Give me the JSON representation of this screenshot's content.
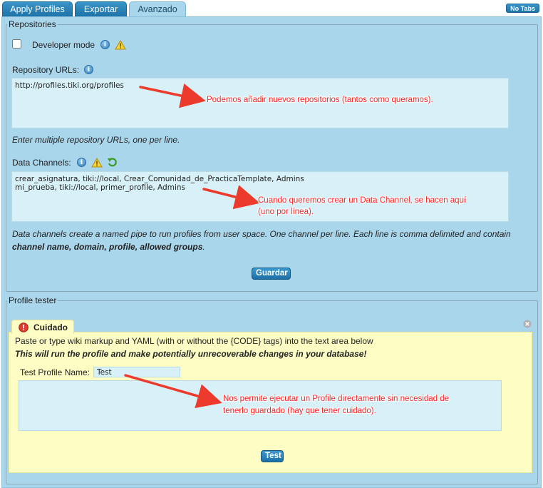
{
  "tabs": [
    {
      "label": "Apply Profiles",
      "active": false
    },
    {
      "label": "Exportar",
      "active": false
    },
    {
      "label": "Avanzado",
      "active": true
    }
  ],
  "no_tabs_label": "No Tabs",
  "repositories": {
    "legend": "Repositories",
    "developer_mode_label": "Developer mode",
    "developer_mode_checked": false,
    "repo_urls_label": "Repository URLs:",
    "repo_urls_value": "http://profiles.tiki.org/profiles",
    "repo_urls_hint": "Enter multiple repository URLs, one per line.",
    "data_channels_label": "Data Channels:",
    "data_channels_value": "crear_asignatura, tiki://local, Crear_Comunidad_de_PracticaTemplate, Admins\nmi_prueba, tiki://local, primer_profile, Admins",
    "data_channels_hint_1": "Data channels create a named pipe to run profiles from user space. One channel per line. Each line is comma delimited and contain",
    "data_channels_hint_2_bold": "channel name, domain, profile, allowed groups",
    "data_channels_hint_2_end": ".",
    "save_button": "Guardar"
  },
  "profile_tester": {
    "legend": "Profile tester",
    "warning_title": "Cuidado",
    "warning_text": "Paste or type wiki markup and YAML (with or without the {CODE} tags) into the text area below",
    "warning_bold": "This will run the profile and make potentially unrecoverable changes in your database!",
    "name_label": "Test Profile Name:",
    "name_value": "Test",
    "yaml_value": "",
    "test_button": "Test"
  },
  "annotations": {
    "repos": "Podemos añadir nuevos repositorios (tantos como queramos).",
    "channels_1": "Cuando queremos crear un Data Channel, se hacen aquí",
    "channels_2": "(uno por línea).",
    "tester_1": "Nos permite ejecutar un Profile directamente sin necesidad de",
    "tester_2": "tenerlo guardado (hay que tener cuidado)."
  },
  "colors": {
    "panel_bg": "#aad6ec",
    "textarea_bg": "#d8f1f8",
    "warning_bg": "#fdfdc4",
    "button_blue": "#1c6fa6",
    "annotation_red": "#ff2222"
  }
}
